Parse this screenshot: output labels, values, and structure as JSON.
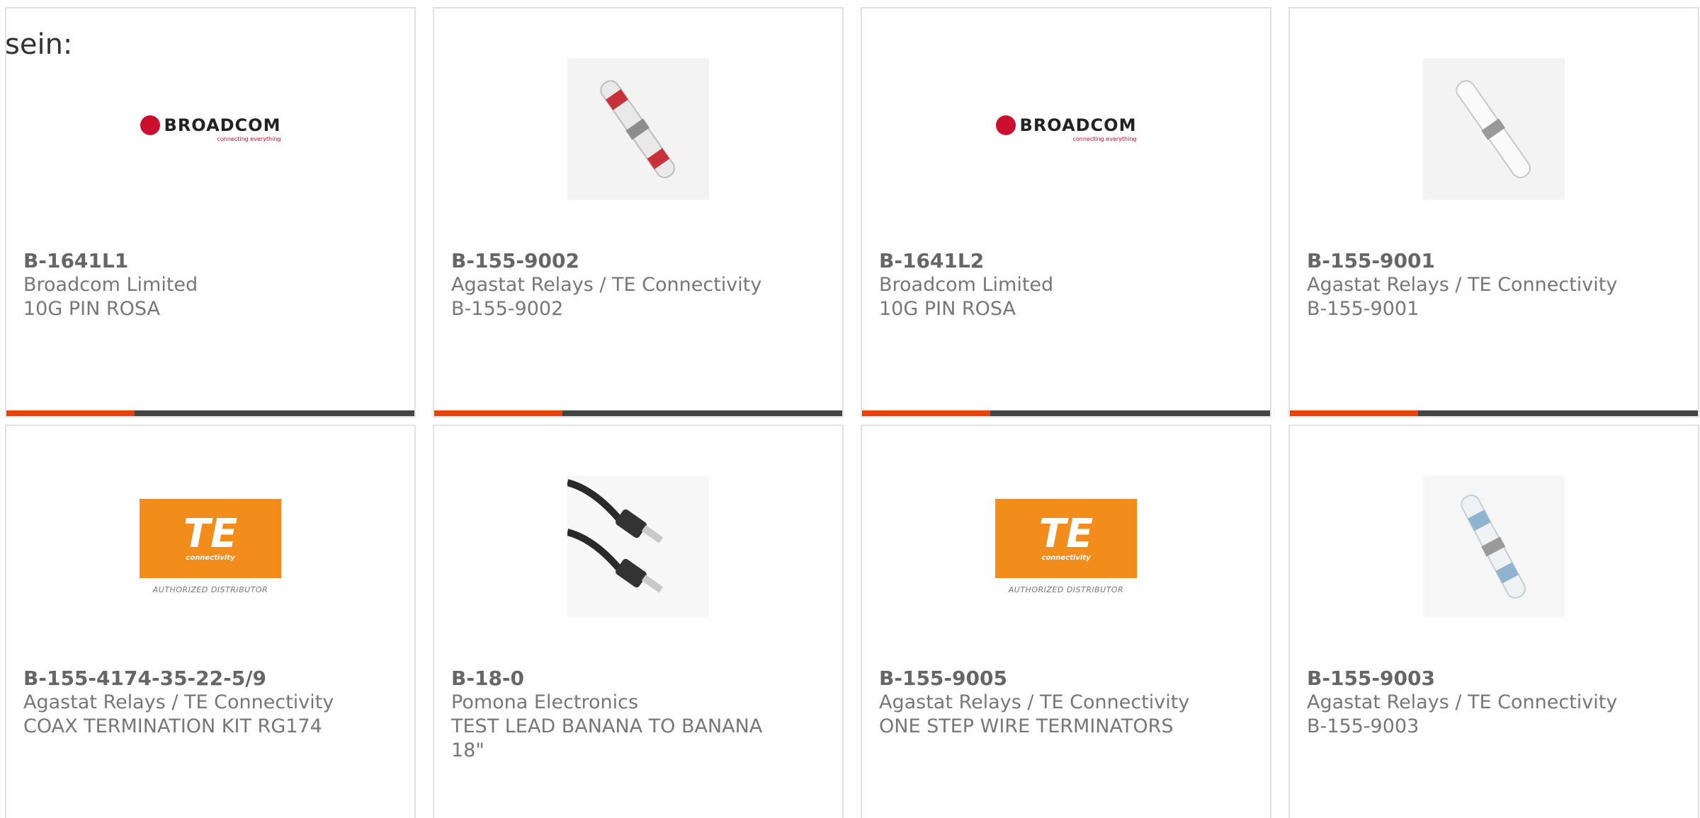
{
  "intro_text": "sein:",
  "brand_colors": {
    "accent": "#e8420a",
    "bar": "#444444",
    "broadcom_red": "#cc0f2e",
    "te_orange": "#f28c1b"
  },
  "products": [
    {
      "part_number": "B-1641L1",
      "manufacturer": "Broadcom Limited",
      "description": "10G PIN ROSA",
      "image": "broadcom-logo",
      "logo": {
        "word": "BROADCOM",
        "tagline": "connecting everything"
      }
    },
    {
      "part_number": "B-155-9002",
      "manufacturer": "Agastat Relays / TE Connectivity",
      "description": "B-155-9002",
      "image": "solder-sleeve-red-photo"
    },
    {
      "part_number": "B-1641L2",
      "manufacturer": "Broadcom Limited",
      "description": "10G PIN ROSA",
      "image": "broadcom-logo",
      "logo": {
        "word": "BROADCOM",
        "tagline": "connecting everything"
      }
    },
    {
      "part_number": "B-155-9001",
      "manufacturer": "Agastat Relays / TE Connectivity",
      "description": "B-155-9001",
      "image": "solder-sleeve-clear-photo"
    },
    {
      "part_number": "B-155-4174-35-22-5/9",
      "manufacturer": "Agastat Relays / TE Connectivity",
      "description": "COAX TERMINATION KIT RG174",
      "image": "te-connectivity-logo",
      "logo": {
        "word": "TE",
        "tagline": "connectivity",
        "distributor": "AUTHORIZED DISTRIBUTOR"
      }
    },
    {
      "part_number": "B-18-0",
      "manufacturer": "Pomona Electronics",
      "description": "TEST LEAD BANANA TO BANANA 18\"",
      "image": "banana-test-lead-photo"
    },
    {
      "part_number": "B-155-9005",
      "manufacturer": "Agastat Relays / TE Connectivity",
      "description": "ONE STEP WIRE TERMINATORS",
      "image": "te-connectivity-logo",
      "logo": {
        "word": "TE",
        "tagline": "connectivity",
        "distributor": "AUTHORIZED DISTRIBUTOR"
      }
    },
    {
      "part_number": "B-155-9003",
      "manufacturer": "Agastat Relays / TE Connectivity",
      "description": "B-155-9003",
      "image": "solder-sleeve-blue-photo"
    }
  ]
}
